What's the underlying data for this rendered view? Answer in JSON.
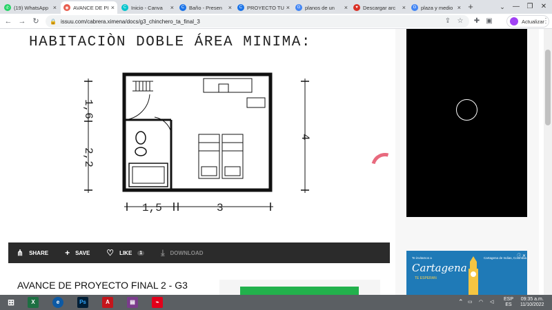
{
  "tabs": [
    {
      "label": "(19) WhatsApp",
      "color": "#25d366",
      "active": false
    },
    {
      "label": "AVANCE DE PI",
      "color": "#e85d4e",
      "active": true
    },
    {
      "label": "Inicio - Canva",
      "color": "#00c4cc",
      "active": false
    },
    {
      "label": "Baño - Presen",
      "color": "#1a73e8",
      "active": false
    },
    {
      "label": "PROYECTO TU",
      "color": "#1a73e8",
      "active": false
    },
    {
      "label": "planos de un",
      "color": "#4285f4",
      "active": false
    },
    {
      "label": "Descargar arc",
      "color": "#d93025",
      "active": false
    },
    {
      "label": "plaza y medio",
      "color": "#4285f4",
      "active": false
    }
  ],
  "address_bar": {
    "url": "issuu.com/cabrera.ximena/docs/g3_chinchero_ta_final_3"
  },
  "update_button": {
    "label": "Actualizar"
  },
  "document": {
    "heading": "HABITACIÒN DOBLE ÁREA MINIMA:",
    "dim_left_top": "1,6",
    "dim_left_bottom": "2,2",
    "dim_right": "4",
    "dim_bottom_left": "1,5",
    "dim_bottom_right": "3"
  },
  "actions": {
    "share": "SHARE",
    "save": "SAVE",
    "like": "LIKE",
    "like_count": "1",
    "download": "DOWNLOAD"
  },
  "doc_title": "AVANCE DE PROYECTO FINAL 2 - G3",
  "ad": {
    "small": "Te invitamos a",
    "brand": "Cartagena",
    "sub": "TE ESPERAN",
    "location": "Cartagena de Indias, Colombia"
  },
  "taskbar": {
    "lang_top": "ESP",
    "lang_bottom": "ES",
    "time": "09:35 a.m.",
    "date": "11/10/2022"
  }
}
